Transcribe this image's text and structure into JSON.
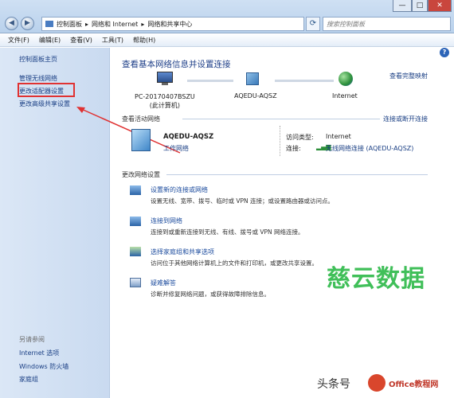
{
  "window": {
    "nav_back": "◀",
    "nav_forward": "▶",
    "breadcrumb": [
      "控制面板",
      "网络和 Internet",
      "网络和共享中心"
    ],
    "refresh_icon": "refresh-icon",
    "search_placeholder": "搜索控制面板",
    "controls": [
      "—",
      "□",
      "✕"
    ]
  },
  "menu": [
    "文件(F)",
    "编辑(E)",
    "查看(V)",
    "工具(T)",
    "帮助(H)"
  ],
  "sidebar": {
    "items": [
      "控制面板主页",
      "管理无线网络",
      "更改适配器设置",
      "更改高级共享设置"
    ],
    "see_also_title": "另请参阅",
    "see_also": [
      "Internet 选项",
      "Windows 防火墙",
      "家庭组"
    ]
  },
  "main": {
    "heading": "查看基本网络信息并设置连接",
    "full_map": "查看完整映射",
    "map_nodes": [
      "PC-20170407BSZU\n(此计算机)",
      "AQEDU-AQSZ",
      "Internet"
    ],
    "active_title": "查看活动网络",
    "connect_disconnect": "连接或断开连接",
    "network_name": "AQEDU-AQSZ",
    "network_type": "工作网络",
    "access_label": "访问类型:",
    "access_value": "Internet",
    "conn_label": "连接:",
    "conn_value": "无线网络连接 (AQEDU-AQSZ)",
    "change_title": "更改网络设置",
    "tasks": [
      {
        "title": "设置新的连接或网络",
        "desc": "设置无线、宽带、拨号、临时或 VPN 连接；或设置路由器或访问点。"
      },
      {
        "title": "连接到网络",
        "desc": "连接到或重新连接到无线、有线、拨号或 VPN 网络连接。"
      },
      {
        "title": "选择家庭组和共享选项",
        "desc": "访问位于其他网络计算机上的文件和打印机，或更改共享设置。"
      },
      {
        "title": "疑难解答",
        "desc": "诊断并修复网络问题，或获得故障排除信息。"
      }
    ]
  },
  "overlay": {
    "watermark": "慈云数据",
    "footer_text": "头条号",
    "footer_site": "Office教程网"
  },
  "colors": {
    "annotation": "#e03232",
    "link": "#1a4a9d",
    "watermark": "#1eb43c"
  }
}
